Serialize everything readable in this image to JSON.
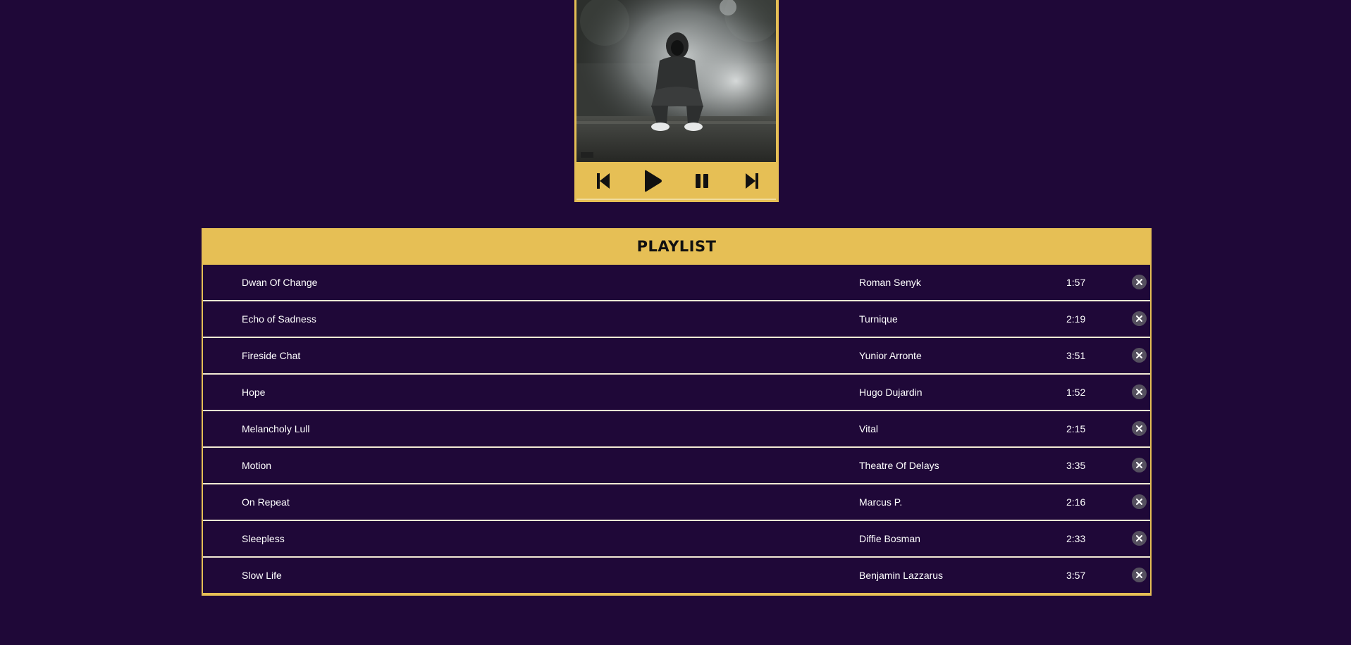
{
  "player": {
    "cover_alt": "album-cover",
    "controls": {
      "previous_icon": "skip-previous-icon",
      "play_icon": "play-icon",
      "pause_icon": "pause-icon",
      "next_icon": "skip-next-icon"
    }
  },
  "playlist": {
    "title": "PLAYLIST",
    "tracks": [
      {
        "title": "Dwan Of Change",
        "artist": "Roman Senyk",
        "duration": "1:57"
      },
      {
        "title": "Echo of Sadness",
        "artist": "Turnique",
        "duration": "2:19"
      },
      {
        "title": "Fireside Chat",
        "artist": "Yunior Arronte",
        "duration": "3:51"
      },
      {
        "title": "Hope",
        "artist": "Hugo Dujardin",
        "duration": "1:52"
      },
      {
        "title": "Melancholy Lull",
        "artist": "Vital",
        "duration": "2:15"
      },
      {
        "title": "Motion",
        "artist": "Theatre Of Delays",
        "duration": "3:35"
      },
      {
        "title": "On Repeat",
        "artist": "Marcus P.",
        "duration": "2:16"
      },
      {
        "title": "Sleepless",
        "artist": "Diffie Bosman",
        "duration": "2:33"
      },
      {
        "title": "Slow Life",
        "artist": "Benjamin Lazzarus",
        "duration": "3:57"
      }
    ],
    "remove_icon": "close-circle-icon"
  },
  "colors": {
    "background": "#1f0838",
    "accent": "#e6bf55",
    "text": "#ffffff",
    "row_divider": "#f3ead4",
    "remove_button": "#55505f"
  }
}
